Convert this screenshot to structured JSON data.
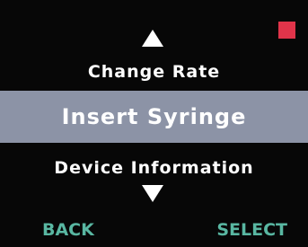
{
  "colors": {
    "background": "#070707",
    "text": "#ffffff",
    "highlight_bar": "#8c93a6",
    "softkey_text": "#59b7a2",
    "status_indicator": "#e1344a"
  },
  "icons": {
    "scroll_up": "triangle-up",
    "scroll_down": "triangle-down",
    "status": "red-square"
  },
  "menu": {
    "previous_item": "Change Rate",
    "selected_item": "Insert Syringe",
    "next_item": "Device Information"
  },
  "softkeys": {
    "back_label": "BACK",
    "select_label": "SELECT"
  }
}
